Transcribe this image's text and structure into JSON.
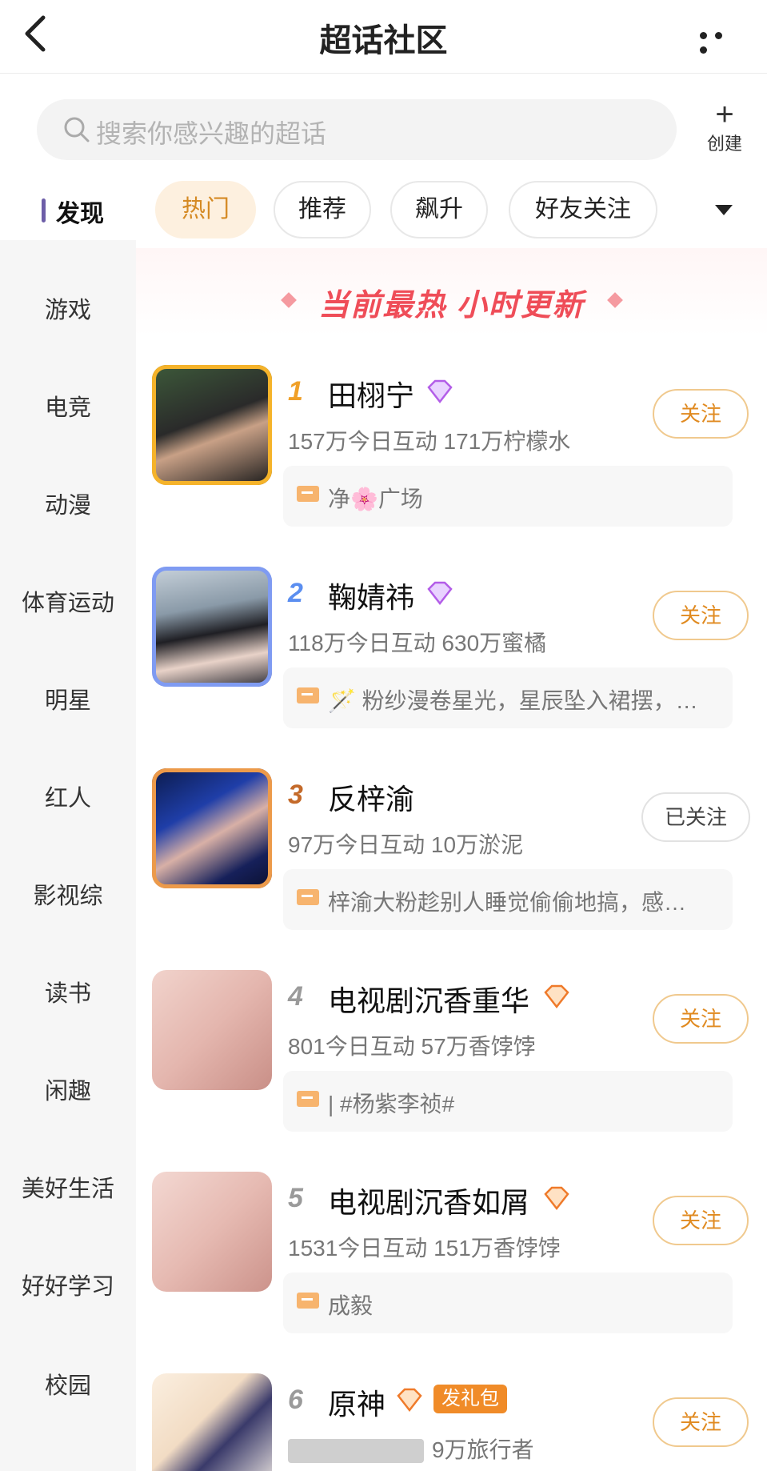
{
  "header": {
    "title": "超话社区"
  },
  "search": {
    "placeholder": "搜索你感兴趣的超话",
    "create_label": "创建"
  },
  "sidebar": {
    "active": "发现",
    "items": [
      "游戏",
      "电竞",
      "动漫",
      "体育运动",
      "明星",
      "红人",
      "影视综",
      "读书",
      "闲趣",
      "美好生活",
      "好好学习",
      "校园"
    ]
  },
  "tabs": [
    "热门",
    "推荐",
    "飙升",
    "好友关注"
  ],
  "banner": {
    "text": "当前最热 小时更新"
  },
  "colors": {
    "accent": "#e08a20",
    "banner": "#ef4d58",
    "rank1": "#f0a028",
    "rank2": "#5b8ef0",
    "rank3": "#c46a2a"
  },
  "items": [
    {
      "rank": "1",
      "name": "田栩宁",
      "stats": "157万今日互动 171万柠檬水",
      "post": "净🌸广场",
      "follow": "关注",
      "badge": "purple-diamond-icon"
    },
    {
      "rank": "2",
      "name": "鞠婧祎",
      "stats": "118万今日互动 630万蜜橘",
      "post": "🪄 粉纱漫卷星光，星辰坠入裙摆，…",
      "follow": "关注",
      "badge": "purple-diamond-icon"
    },
    {
      "rank": "3",
      "name": "反梓渝",
      "stats": "97万今日互动 10万淤泥",
      "post": "梓渝大粉趁别人睡觉偷偷地搞，感…",
      "follow": "已关注",
      "badge": ""
    },
    {
      "rank": "4",
      "name": "电视剧沉香重华",
      "stats": "801今日互动 57万香饽饽",
      "post": "| #杨紫李祯#",
      "follow": "关注",
      "badge": "orange-diamond-icon"
    },
    {
      "rank": "5",
      "name": "电视剧沉香如屑",
      "stats": "1531今日互动 151万香饽饽",
      "post": "成毅",
      "follow": "关注",
      "badge": "orange-diamond-icon"
    },
    {
      "rank": "6",
      "name": "原神",
      "stats": "9万旅行者",
      "post": "",
      "follow": "关注",
      "badge": "orange-diamond-icon",
      "tag": "发礼包"
    }
  ]
}
